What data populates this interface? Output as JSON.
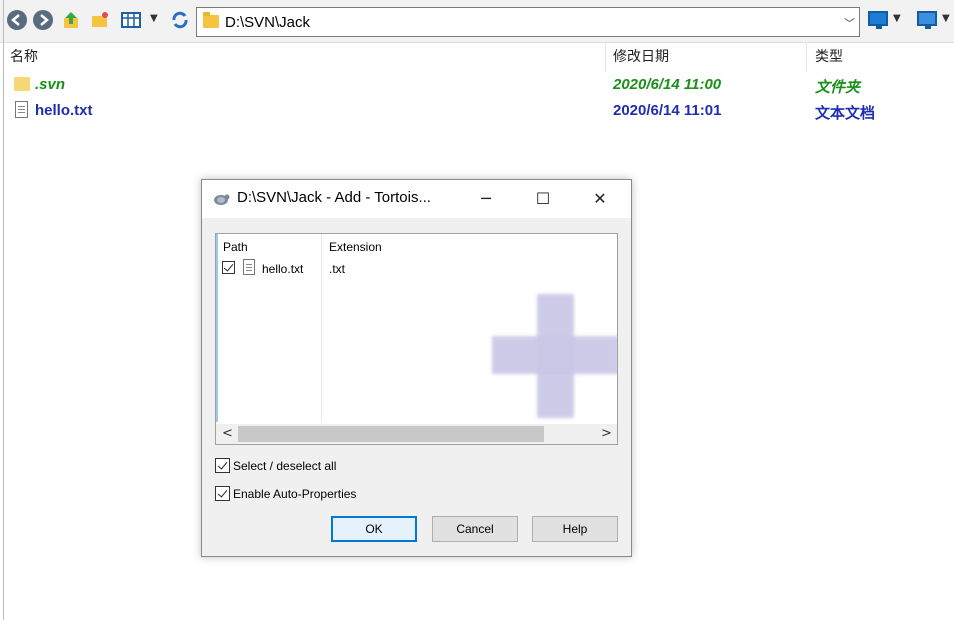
{
  "explorer": {
    "address_path": "D:\\SVN\\Jack",
    "columns": {
      "name": "名称",
      "modified": "修改日期",
      "type": "类型"
    },
    "files": [
      {
        "name": ".svn",
        "modified": "2020/6/14 11:00",
        "type": "文件夹",
        "color": "#1a8f1a",
        "icon": "folder-icon"
      },
      {
        "name": "hello.txt",
        "modified": "2020/6/14 11:01",
        "type": "文本文档",
        "color": "#1f2db0",
        "icon": "text-file-icon"
      }
    ]
  },
  "dialog": {
    "title": "D:\\SVN\\Jack - Add - Tortois...",
    "list": {
      "headers": {
        "path": "Path",
        "extension": "Extension"
      },
      "items": [
        {
          "checked": true,
          "path": "hello.txt",
          "extension": ".txt"
        }
      ]
    },
    "options": {
      "select_all": {
        "label": "Select / deselect all",
        "checked": true
      },
      "auto_props": {
        "label": "Enable Auto-Properties",
        "checked": true
      }
    },
    "buttons": {
      "ok": "OK",
      "cancel": "Cancel",
      "help": "Help"
    }
  },
  "colors": {
    "accent": "#0078d7",
    "svn_green": "#1a8f1a",
    "modified_blue": "#1f2db0"
  }
}
